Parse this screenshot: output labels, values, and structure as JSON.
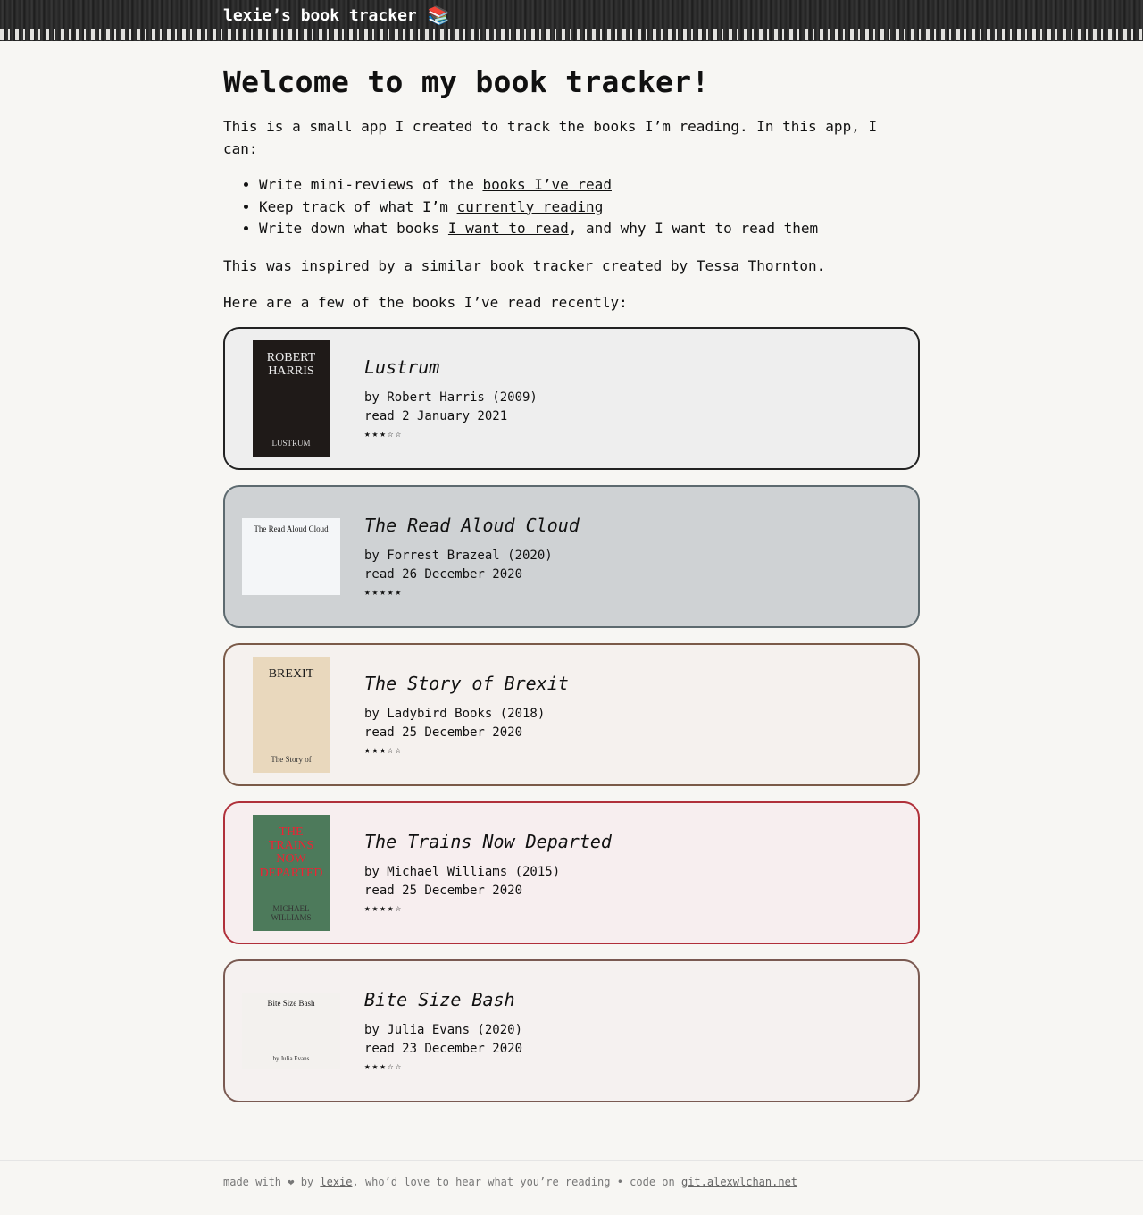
{
  "header": {
    "title": "lexie’s book tracker",
    "icon": "books-icon"
  },
  "intro": {
    "heading": "Welcome to my book tracker!",
    "para1": "This is a small app I created to track the books I’m reading. In this app, I can:",
    "list": [
      {
        "pre": "Write mini-reviews of the ",
        "link": "books I’ve read",
        "post": ""
      },
      {
        "pre": "Keep track of what I’m ",
        "link": "currently reading",
        "post": ""
      },
      {
        "pre": "Write down what books ",
        "link": "I want to read",
        "post": ", and why I want to read them"
      }
    ],
    "para2_pre": "This was inspired by a ",
    "para2_link1": "similar book tracker",
    "para2_mid": " created by ",
    "para2_link2": "Tessa Thornton",
    "para2_post": ".",
    "para3": "Here are a few of the books I’ve read recently:"
  },
  "books": [
    {
      "title": "Lustrum",
      "by": "by Robert Harris (2009)",
      "read": "read 2 January 2021",
      "stars": "★★★☆☆",
      "rating": 3,
      "bg": "#eeeeee",
      "border": "#222222",
      "cover_bg": "#1f1a18",
      "cover_text": "ROBERT HARRIS",
      "cover_sub": "LUSTRUM"
    },
    {
      "title": "The Read Aloud Cloud",
      "by": "by Forrest Brazeal (2020)",
      "read": "read 26 December 2020",
      "stars": "★★★★★",
      "rating": 5,
      "bg": "#cfd2d4",
      "border": "#5d6a6f",
      "cover_bg": "#f4f6f8",
      "cover_text": "The Read Aloud Cloud",
      "cover_sub": ""
    },
    {
      "title": "The Story of Brexit",
      "by": "by Ladybird Books (2018)",
      "read": "read 25 December 2020",
      "stars": "★★★☆☆",
      "rating": 3,
      "bg": "#f5f1ee",
      "border": "#7a5a48",
      "cover_bg": "#e9d8bd",
      "cover_text": "BREXIT",
      "cover_sub": "The Story of"
    },
    {
      "title": "The Trains Now Departed",
      "by": "by Michael Williams (2015)",
      "read": "read 25 December 2020",
      "stars": "★★★★☆",
      "rating": 4,
      "bg": "#f7eeef",
      "border": "#b0303a",
      "cover_bg": "#4d7a5b",
      "cover_text": "THE TRAINS NOW DEPARTED",
      "cover_sub": "MICHAEL WILLIAMS"
    },
    {
      "title": "Bite Size Bash",
      "by": "by Julia Evans (2020)",
      "read": "read 23 December 2020",
      "stars": "★★★☆☆",
      "rating": 3,
      "bg": "#f5f1f0",
      "border": "#7a5a52",
      "cover_bg": "#f3f1ee",
      "cover_text": "Bite Size Bash",
      "cover_sub": "by Julia Evans"
    }
  ],
  "footer": {
    "pre": "made with ❤ by ",
    "link1": "lexie",
    "mid": ", who’d love to hear what you’re reading • code on ",
    "link2": "git.alexwlchan.net"
  }
}
